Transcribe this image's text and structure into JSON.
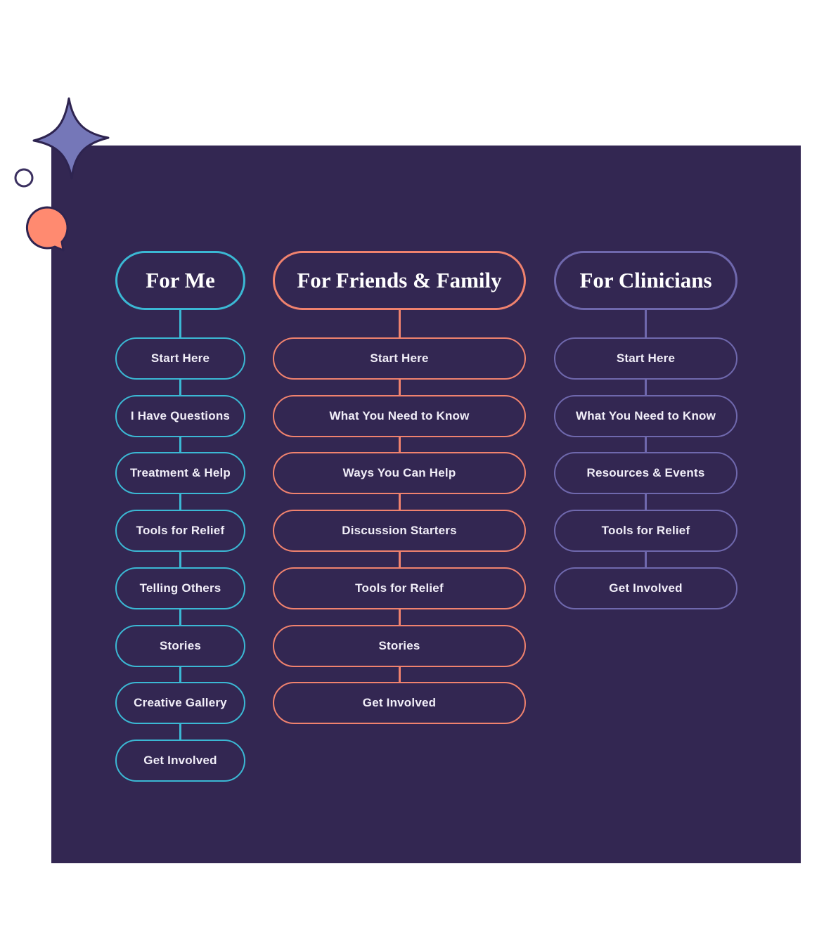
{
  "colors": {
    "background": "#332752",
    "for_me": "#3bb8d4",
    "friends_family": "#f0826e",
    "clinicians": "#6f68ad",
    "star": "#7577b8",
    "bubble": "#ff8a70"
  },
  "decorations": {
    "icons": [
      "sparkle-star-icon",
      "circle-outline-icon",
      "speech-bubble-icon"
    ]
  },
  "columns": [
    {
      "id": "for-me",
      "title": "For Me",
      "color": "#3bb8d4",
      "items": [
        "Start Here",
        "I Have Questions",
        "Treatment & Help",
        "Tools for Relief",
        "Telling Others",
        "Stories",
        "Creative Gallery",
        "Get Involved"
      ]
    },
    {
      "id": "friends-family",
      "title": "For Friends & Family",
      "color": "#f0826e",
      "items": [
        "Start Here",
        "What You Need to Know",
        "Ways You Can Help",
        "Discussion Starters",
        "Tools for Relief",
        "Stories",
        "Get Involved"
      ]
    },
    {
      "id": "clinicians",
      "title": "For Clinicians",
      "color": "#6f68ad",
      "items": [
        "Start Here",
        "What You Need to Know",
        "Resources & Events",
        "Tools for Relief",
        "Get Involved"
      ]
    }
  ]
}
